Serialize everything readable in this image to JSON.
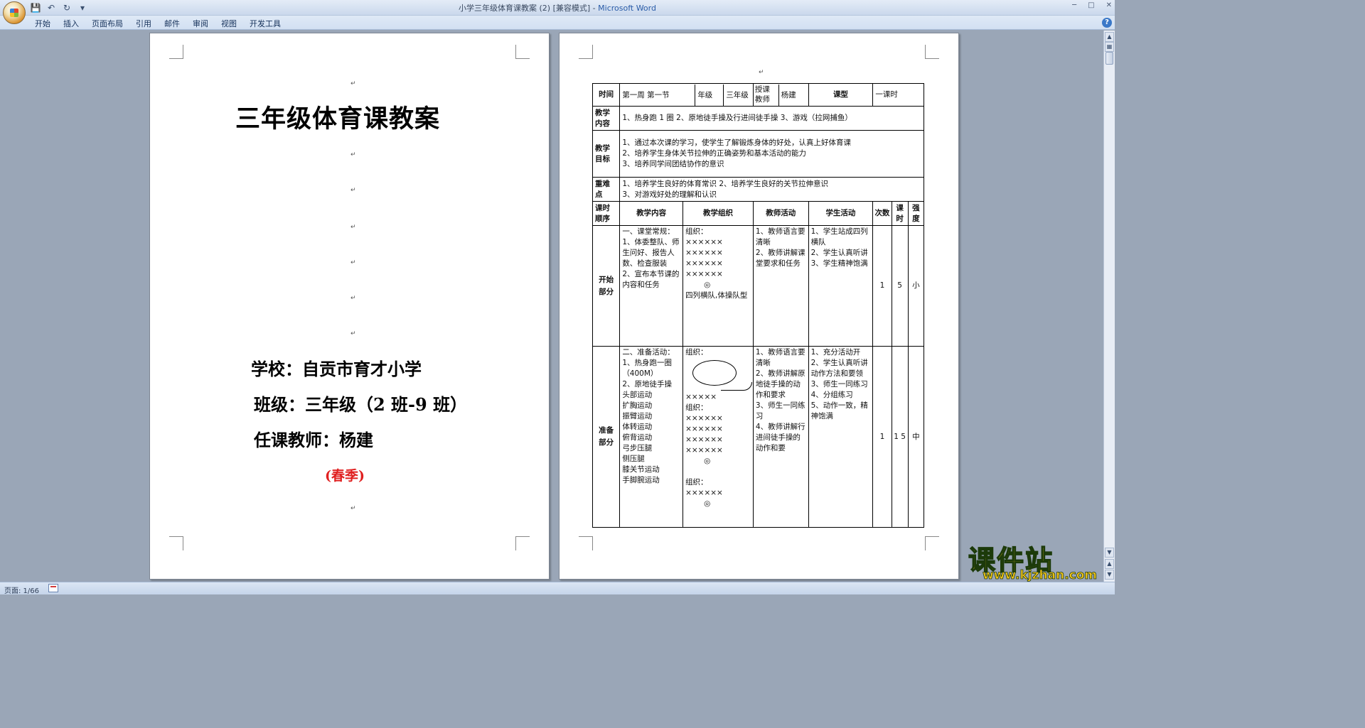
{
  "window": {
    "title_doc": "小学三年级体育课教案 (2) [兼容模式] - ",
    "title_app": "Microsoft Word"
  },
  "ribbon": {
    "tabs": [
      "开始",
      "插入",
      "页面布局",
      "引用",
      "邮件",
      "审阅",
      "视图",
      "开发工具"
    ]
  },
  "icons": {
    "office_button": "office-logo-icon",
    "save": "save-icon",
    "undo": "undo-icon",
    "redo": "redo-icon",
    "help": "help-icon"
  },
  "cover": {
    "title": "三年级体育课教案",
    "school": "学校：自贡市育才小学",
    "class": "班级：三年级（2 班-9 班）",
    "teacher": "任课教师：杨建",
    "season": "(春季)",
    "season_color": "#e02020"
  },
  "lesson": {
    "time_label": "时间",
    "time_value": "第一周   第一节",
    "grade_label": "年级",
    "grade_value": "三年级",
    "instructor_label": "授课教师",
    "instructor_value": "杨建",
    "type_label": "课型",
    "type_value": "一课时",
    "content_label": "教学内容",
    "content_value": "1、热身跑 1 圈   2、原地徒手操及行进间徒手操  3、游戏（拉网捕鱼）",
    "goals_label": "教学目标",
    "goals": [
      "1、通过本次课的学习，使学生了解锻炼身体的好处，认真上好体育课",
      "2、培养学生身体关节拉伸的正确姿势和基本活动的能力",
      "3、培养同学间团结协作的意识"
    ],
    "key_label": "重难点",
    "key_points": [
      "1、培养学生良好的体育常识   2、培养学生良好的关节拉伸意识",
      "3、对游戏好处的理解和认识"
    ],
    "headers": [
      "课时顺序",
      "教学内容",
      "教学组织",
      "教师活动",
      "学生活动",
      "次数",
      "课时",
      "强度"
    ],
    "sections": [
      {
        "name": "开始部分",
        "content": [
          "一、课堂常规：",
          "1、体委整队、师生问好、报告人数、检查服装",
          "2、宣布本节课的内容和任务"
        ],
        "org": [
          "组织：",
          "××××××",
          "××××××",
          "××××××",
          "××××××",
          "◎",
          "四列横队,体操队型"
        ],
        "teacher": [
          "1、教师语言要清晰",
          "2、教师讲解课堂要求和任务"
        ],
        "student": [
          "1、学生站成四列横队",
          "2、学生认真听讲",
          "3、学生精神饱满"
        ],
        "times": "1",
        "minutes": "5",
        "intensity": "小"
      },
      {
        "name": "准备部分",
        "content": [
          "二、准备活动：",
          "1、热身跑一圈（400M）",
          "2、原地徒手操",
          "头部运动",
          "扩胸运动",
          "振臂运动",
          "体转运动",
          "俯背运动",
          "弓步压腿",
          "侧压腿",
          "膝关节运动",
          "手脚腕运动"
        ],
        "org": [
          "组织：",
          "×××××",
          "组织：",
          "××××××",
          "××××××",
          "××××××",
          "××××××",
          "◎",
          "",
          "组织：",
          "××××××",
          "◎"
        ],
        "teacher": [
          "1、教师语言要清晰",
          "2、教师讲解原地徒手操的动作和要求",
          "3、师生一同练习",
          "4、教师讲解行进间徒手操的动作和要"
        ],
        "student": [
          "1、充分活动开",
          "2、学生认真听讲动作方法和要领",
          "3、师生一同练习",
          "4、分组练习",
          "5、动作一致，精神饱满"
        ],
        "times": "1",
        "minutes": "1 5",
        "intensity": "中"
      }
    ]
  },
  "status": {
    "page": "页面: 1/66"
  },
  "watermark": {
    "text": "课件站",
    "url": "www.kjzhan.com"
  }
}
